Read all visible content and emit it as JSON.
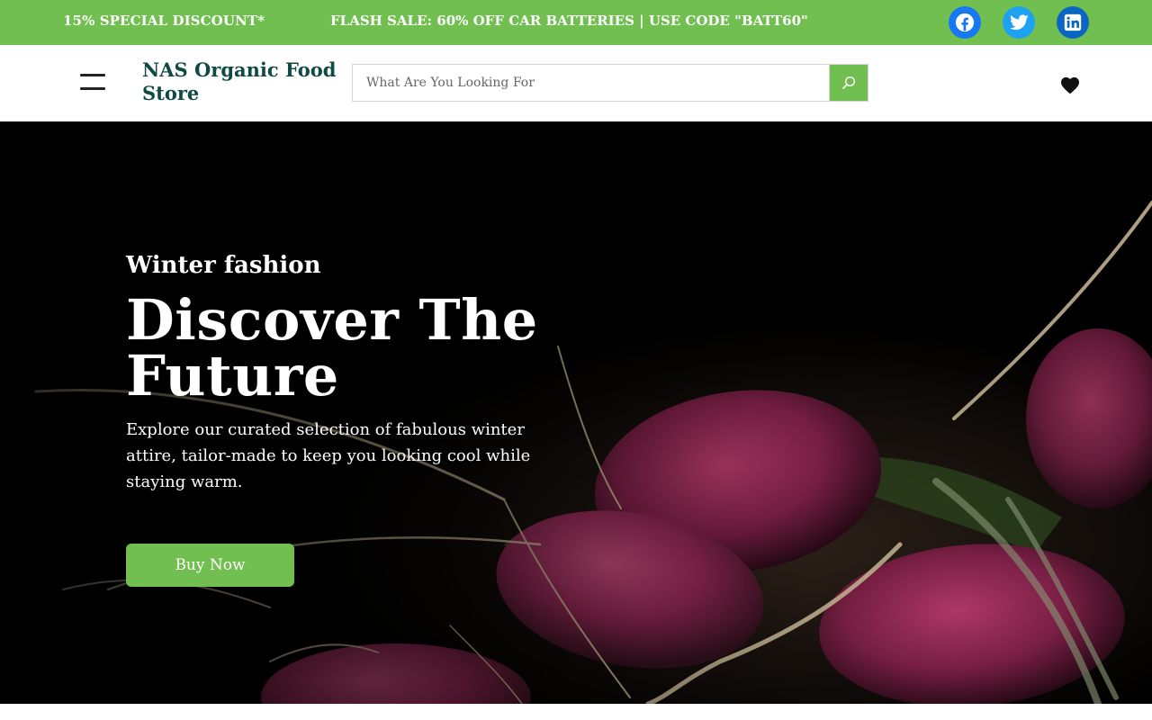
{
  "topbar": {
    "promo_left": "15% SPECIAL DISCOUNT*",
    "promo_center": "FLASH SALE: 60% OFF CAR BATTERIES | USE CODE \"BATT60\"",
    "background_color": "#71bf50",
    "social": [
      {
        "icon": "facebook-icon",
        "color": "#1877f2"
      },
      {
        "icon": "twitter-icon",
        "color": "#1da1f2"
      },
      {
        "icon": "linkedin-icon",
        "color": "#0a66c2"
      }
    ]
  },
  "header": {
    "menu_icon": "hamburger-icon",
    "site_title": "NAS Organic Food Store",
    "title_color": "#0f4a45",
    "search": {
      "placeholder": "What Are You Looking For",
      "value": "",
      "button_icon": "search-icon"
    },
    "wishlist_icon": "heart-icon"
  },
  "hero": {
    "eyebrow": "Winter fashion",
    "title": "Discover The Future",
    "description": "Explore our curated selection of fabulous winter attire, tailor-made to keep you looking cool while staying warm.",
    "cta_label": "Buy Now",
    "cta_color": "#71bf50",
    "background_image": "radishes-photo"
  }
}
